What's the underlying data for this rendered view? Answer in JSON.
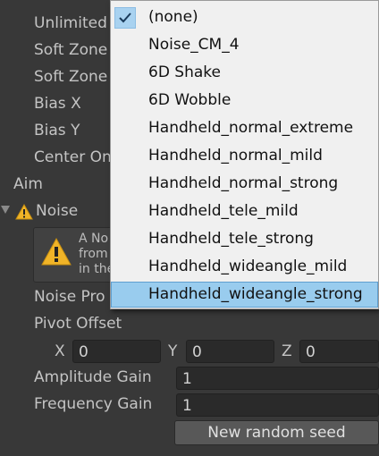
{
  "props": {
    "unlimited": "Unlimited",
    "soft_zone_w": "Soft Zone",
    "soft_zone_h": "Soft Zone",
    "bias_x": "Bias X",
    "bias_y": "Bias Y",
    "center_on": "Center On",
    "aim": "Aim",
    "noise": "Noise",
    "noise_profile": "Noise Pro",
    "pivot_offset": "Pivot Offset",
    "amplitude_gain": "Amplitude Gain",
    "frequency_gain": "Frequency Gain"
  },
  "warning": {
    "lines": [
      "A No",
      "from",
      "in the"
    ]
  },
  "pivot": {
    "x_label": "X",
    "x_value": "0",
    "y_label": "Y",
    "y_value": "0",
    "z_label": "Z",
    "z_value": "0"
  },
  "amplitude_value": "1",
  "frequency_value": "1",
  "new_seed_label": "New random seed",
  "dropdown": {
    "items": [
      "(none)",
      "Noise_CM_4",
      "6D Shake",
      "6D Wobble",
      "Handheld_normal_extreme",
      "Handheld_normal_mild",
      "Handheld_normal_strong",
      "Handheld_tele_mild",
      "Handheld_tele_strong",
      "Handheld_wideangle_mild",
      "Handheld_wideangle_strong"
    ],
    "checked": "(none)",
    "highlighted": "Handheld_wideangle_strong"
  }
}
